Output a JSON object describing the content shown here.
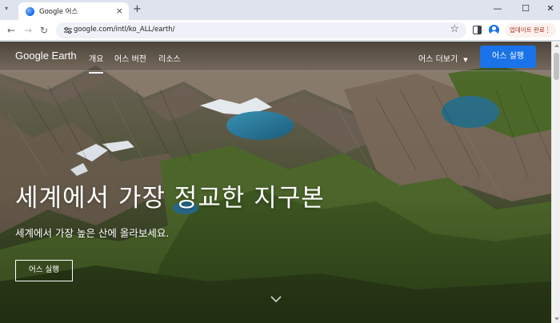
{
  "browser": {
    "tab": {
      "title": "Google 어스",
      "icon": "google-earth-favicon"
    },
    "address_bar": {
      "url": "google.com/intl/ko_ALL/earth/"
    },
    "update_button": {
      "label": "업데이트 완료"
    },
    "new_tab": "+",
    "tab_close": "×",
    "window_controls": {
      "minimize": "—",
      "maximize": "☐",
      "close": "✕"
    },
    "nav": {
      "back": "←",
      "forward": "→",
      "reload": "↻"
    },
    "star": "☆",
    "menu_dots": "⋮"
  },
  "site_nav": {
    "brand": "Google Earth",
    "links": [
      "개요",
      "어스 버전",
      "리소스"
    ],
    "active_link": "개요",
    "more_label": "어스 더보기",
    "more_caret": "▼",
    "launch_label": "어스 실행"
  },
  "hero": {
    "title": "세계에서 가장 정교한 지구본",
    "subtitle": "세계에서 가장 높은 산에 올라보세요.",
    "cta_label": "어스 실행"
  },
  "colors": {
    "accent": "#1a73e8",
    "tabstrip": "#dee3ee",
    "lake": "#2a7da0"
  }
}
